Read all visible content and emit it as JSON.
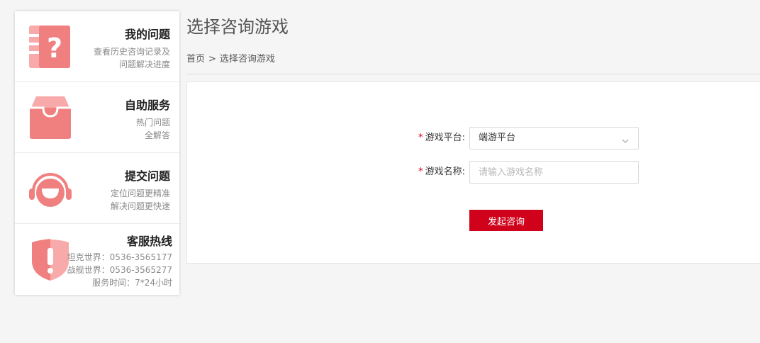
{
  "sidebar": {
    "items": [
      {
        "title": "我的问题",
        "desc_lines": [
          "查看历史咨询记录及",
          "问题解决进度"
        ],
        "icon": "question-book-icon"
      },
      {
        "title": "自助服务",
        "desc_lines": [
          "热门问题",
          "全解答"
        ],
        "icon": "inbox-tray-icon"
      },
      {
        "title": "提交问题",
        "desc_lines": [
          "定位问题更精准",
          "解决问题更快速"
        ],
        "icon": "headset-icon"
      },
      {
        "title": "客服热线",
        "desc_lines": [
          "坦克世界：0536-3565177",
          "战舰世界：0536-3565277",
          "服务时间：7*24小时"
        ],
        "icon": "shield-alert-icon"
      }
    ]
  },
  "main": {
    "title": "选择咨询游戏",
    "breadcrumb": {
      "home": "首页",
      "separator": ">",
      "current": "选择咨询游戏"
    }
  },
  "form": {
    "required_mark": "*",
    "platform": {
      "label": "游戏平台:",
      "value": "端游平台"
    },
    "game_name": {
      "label": "游戏名称:",
      "placeholder": "请输入游戏名称",
      "value": ""
    },
    "submit_label": "发起咨询"
  },
  "colors": {
    "accent": "#d0021b",
    "icon_pink": "#f08080",
    "icon_pink_light": "#f8a9a9",
    "page_bg": "#f5f5f5"
  }
}
